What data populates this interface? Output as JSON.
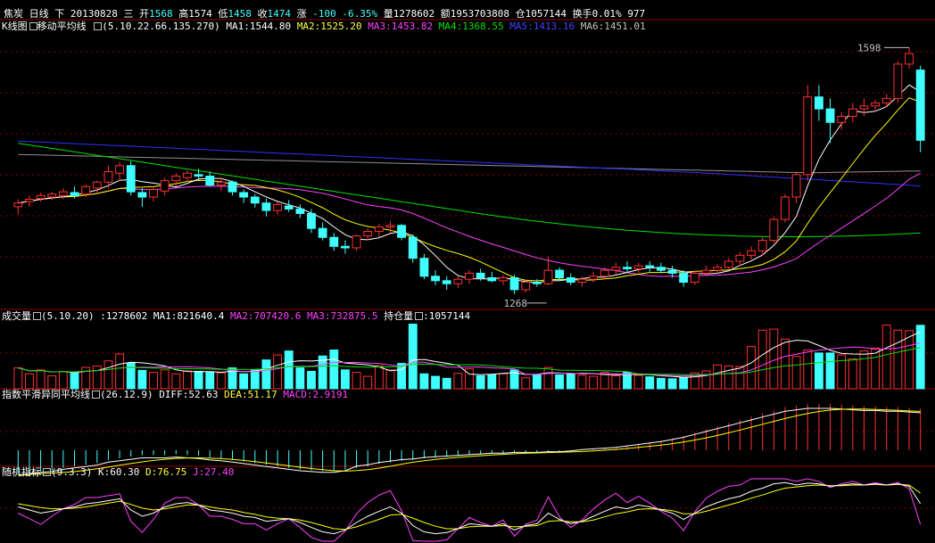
{
  "header": {
    "name": "焦炭",
    "period": "日线",
    "direction": "下",
    "date": "20130828",
    "weekday": "三",
    "open_label": "开",
    "open": "1568",
    "high_label": "高",
    "high": "1574",
    "low_label": "低",
    "low": "1458",
    "close_label": "收",
    "close": "1474",
    "change_label": "涨",
    "change": "-100",
    "change_pct": "-6.35%",
    "volume_label": "量",
    "volume": "1278602",
    "amount_label": "额",
    "amount": "1953703808",
    "oi_label": "仓",
    "oi": "1057144",
    "turnover_label": "换手",
    "turnover": "0.01%",
    "extra": "977"
  },
  "kline_panel": {
    "title": "K线图",
    "indicator": "移动平均线",
    "params": "(5.10.22.66.135.270)",
    "ma1": "MA1:1544.80",
    "ma2": "MA2:1525.20",
    "ma3": "MA3:1453.82",
    "ma4": "MA4:1368.55",
    "ma5": "MA5:1413.16",
    "ma6": "MA6:1451.01",
    "high_mark": "1598",
    "low_mark": "1268"
  },
  "volume_panel": {
    "title": "成交量",
    "params": "(5.10.20)",
    "vol": ":1278602",
    "ma1": "MA1:821640.4",
    "ma2": "MA2:707420.6",
    "ma3": "MA3:732875.5",
    "oi_label": "持仓量",
    "oi": ":1057144"
  },
  "macd_panel": {
    "title": "指数平滑异同平均线",
    "params": "(26.12.9)",
    "diff": "DIFF:52.63",
    "dea": "DEA:51.17",
    "macd": "MACD:2.9191"
  },
  "kdj_panel": {
    "title": "随机指标",
    "params": "(9.3.3)",
    "k": "K:60.30",
    "d": "D:76.75",
    "j": "J:27.40"
  },
  "colors": {
    "up": "#ff3030",
    "down": "#40ffff",
    "ma1": "#ffffff",
    "ma2": "#ffff00",
    "ma3": "#ff40ff",
    "ma4": "#00e000",
    "ma5": "#3030ff",
    "ma6": "#909090",
    "grid": "#8b0000"
  },
  "chart_data": {
    "type": "candlestick",
    "price_range": [
      1250,
      1620
    ],
    "candles": [
      [
        1385,
        1395,
        1375,
        1390
      ],
      [
        1392,
        1400,
        1385,
        1395
      ],
      [
        1396,
        1404,
        1392,
        1400
      ],
      [
        1398,
        1405,
        1394,
        1402
      ],
      [
        1400,
        1410,
        1395,
        1405
      ],
      [
        1404,
        1412,
        1396,
        1400
      ],
      [
        1402,
        1415,
        1398,
        1412
      ],
      [
        1410,
        1420,
        1404,
        1418
      ],
      [
        1418,
        1440,
        1410,
        1432
      ],
      [
        1430,
        1445,
        1420,
        1440
      ],
      [
        1440,
        1446,
        1400,
        1405
      ],
      [
        1404,
        1410,
        1385,
        1398
      ],
      [
        1398,
        1412,
        1392,
        1408
      ],
      [
        1406,
        1424,
        1400,
        1420
      ],
      [
        1420,
        1430,
        1412,
        1426
      ],
      [
        1424,
        1434,
        1418,
        1430
      ],
      [
        1428,
        1436,
        1420,
        1426
      ],
      [
        1426,
        1432,
        1412,
        1414
      ],
      [
        1414,
        1424,
        1406,
        1418
      ],
      [
        1418,
        1420,
        1400,
        1405
      ],
      [
        1404,
        1408,
        1390,
        1398
      ],
      [
        1398,
        1402,
        1384,
        1390
      ],
      [
        1390,
        1396,
        1372,
        1380
      ],
      [
        1380,
        1392,
        1374,
        1388
      ],
      [
        1386,
        1394,
        1378,
        1382
      ],
      [
        1382,
        1388,
        1370,
        1376
      ],
      [
        1376,
        1382,
        1350,
        1356
      ],
      [
        1356,
        1364,
        1340,
        1344
      ],
      [
        1344,
        1350,
        1326,
        1332
      ],
      [
        1332,
        1340,
        1322,
        1330
      ],
      [
        1330,
        1348,
        1326,
        1346
      ],
      [
        1346,
        1356,
        1340,
        1352
      ],
      [
        1352,
        1362,
        1344,
        1358
      ],
      [
        1358,
        1366,
        1350,
        1360
      ],
      [
        1360,
        1362,
        1340,
        1344
      ],
      [
        1344,
        1348,
        1310,
        1316
      ],
      [
        1316,
        1322,
        1288,
        1292
      ],
      [
        1292,
        1300,
        1280,
        1286
      ],
      [
        1286,
        1292,
        1274,
        1282
      ],
      [
        1282,
        1292,
        1276,
        1288
      ],
      [
        1288,
        1300,
        1282,
        1296
      ],
      [
        1296,
        1302,
        1286,
        1290
      ],
      [
        1290,
        1298,
        1284,
        1286
      ],
      [
        1286,
        1294,
        1280,
        1290
      ],
      [
        1290,
        1294,
        1268,
        1274
      ],
      [
        1274,
        1286,
        1270,
        1284
      ],
      [
        1284,
        1288,
        1278,
        1282
      ],
      [
        1282,
        1318,
        1280,
        1300
      ],
      [
        1300,
        1304,
        1286,
        1290
      ],
      [
        1290,
        1296,
        1280,
        1284
      ],
      [
        1284,
        1292,
        1278,
        1288
      ],
      [
        1288,
        1298,
        1284,
        1292
      ],
      [
        1292,
        1304,
        1288,
        1300
      ],
      [
        1300,
        1310,
        1294,
        1304
      ],
      [
        1304,
        1312,
        1296,
        1302
      ],
      [
        1302,
        1310,
        1296,
        1306
      ],
      [
        1306,
        1312,
        1298,
        1304
      ],
      [
        1304,
        1310,
        1296,
        1300
      ],
      [
        1300,
        1306,
        1290,
        1296
      ],
      [
        1296,
        1300,
        1278,
        1284
      ],
      [
        1284,
        1300,
        1280,
        1296
      ],
      [
        1296,
        1306,
        1292,
        1300
      ],
      [
        1300,
        1308,
        1296,
        1304
      ],
      [
        1304,
        1316,
        1300,
        1312
      ],
      [
        1312,
        1324,
        1306,
        1320
      ],
      [
        1320,
        1332,
        1314,
        1326
      ],
      [
        1326,
        1344,
        1320,
        1340
      ],
      [
        1340,
        1372,
        1336,
        1368
      ],
      [
        1368,
        1402,
        1364,
        1398
      ],
      [
        1398,
        1432,
        1390,
        1428
      ],
      [
        1428,
        1548,
        1420,
        1532
      ],
      [
        1532,
        1548,
        1500,
        1516
      ],
      [
        1516,
        1530,
        1470,
        1498
      ],
      [
        1498,
        1512,
        1488,
        1506
      ],
      [
        1506,
        1524,
        1498,
        1516
      ],
      [
        1516,
        1530,
        1506,
        1520
      ],
      [
        1520,
        1528,
        1512,
        1524
      ],
      [
        1524,
        1536,
        1518,
        1530
      ],
      [
        1530,
        1580,
        1524,
        1576
      ],
      [
        1576,
        1598,
        1570,
        1590
      ],
      [
        1568,
        1574,
        1458,
        1474
      ]
    ],
    "volume": [
      420,
      300,
      380,
      260,
      350,
      330,
      430,
      460,
      560,
      700,
      520,
      370,
      330,
      380,
      300,
      360,
      350,
      330,
      320,
      420,
      300,
      380,
      580,
      680,
      760,
      420,
      350,
      660,
      780,
      380,
      330,
      250,
      460,
      380,
      510,
      1300,
      300,
      250,
      210,
      310,
      400,
      260,
      280,
      300,
      380,
      220,
      280,
      430,
      280,
      300,
      270,
      250,
      330,
      260,
      330,
      270,
      240,
      210,
      200,
      230,
      320,
      360,
      480,
      460,
      450,
      850,
      1180,
      1200,
      1000,
      650,
      780,
      720,
      720,
      680,
      600,
      760,
      820,
      1280,
      1180,
      1170,
      1278
    ],
    "macd_hist": [
      -30,
      -28,
      -26,
      -25,
      -22,
      -20,
      -18,
      -16,
      -12,
      -10,
      -8,
      -6,
      -6,
      -6,
      -5,
      -6,
      -7,
      -9,
      -10,
      -12,
      -14,
      -16,
      -18,
      -20,
      -22,
      -24,
      -25,
      -26,
      -26,
      -24,
      -22,
      -20,
      -17,
      -15,
      -13,
      -12,
      -10,
      -9,
      -8,
      -7,
      -6,
      -5,
      -4,
      -4,
      -3,
      -3,
      -3,
      -2,
      -2,
      -1,
      1,
      2,
      3,
      4,
      6,
      8,
      10,
      12,
      15,
      18,
      22,
      26,
      30,
      34,
      38,
      42,
      46,
      50,
      54,
      56,
      58,
      58,
      58,
      57,
      56,
      55,
      55,
      54,
      54,
      53,
      52
    ],
    "kd_k": [
      55,
      50,
      45,
      48,
      52,
      55,
      60,
      62,
      65,
      68,
      50,
      40,
      45,
      55,
      60,
      62,
      58,
      50,
      48,
      45,
      40,
      38,
      32,
      34,
      36,
      30,
      22,
      15,
      12,
      18,
      30,
      40,
      48,
      55,
      45,
      25,
      15,
      12,
      14,
      20,
      28,
      26,
      24,
      28,
      18,
      25,
      28,
      45,
      35,
      28,
      32,
      40,
      48,
      55,
      52,
      58,
      55,
      50,
      45,
      35,
      45,
      55,
      62,
      68,
      72,
      80,
      85,
      92,
      94,
      90,
      93,
      92,
      88,
      90,
      92,
      90,
      92,
      90,
      92,
      88,
      60
    ],
    "kd_d": [
      60,
      57,
      54,
      52,
      52,
      53,
      55,
      58,
      61,
      64,
      59,
      53,
      50,
      52,
      55,
      58,
      58,
      55,
      52,
      50,
      46,
      43,
      39,
      37,
      36,
      34,
      30,
      25,
      20,
      19,
      23,
      29,
      35,
      42,
      43,
      37,
      30,
      24,
      20,
      20,
      23,
      24,
      24,
      25,
      23,
      24,
      25,
      32,
      33,
      31,
      31,
      34,
      39,
      44,
      47,
      51,
      52,
      51,
      49,
      44,
      44,
      48,
      53,
      58,
      63,
      69,
      74,
      80,
      85,
      87,
      89,
      90,
      89,
      89,
      90,
      90,
      91,
      90,
      91,
      90,
      77
    ],
    "kd_j": [
      45,
      36,
      27,
      40,
      52,
      59,
      70,
      70,
      73,
      76,
      32,
      14,
      35,
      61,
      70,
      70,
      58,
      40,
      40,
      35,
      28,
      28,
      18,
      28,
      36,
      22,
      6,
      0,
      0,
      16,
      44,
      62,
      74,
      81,
      49,
      1,
      0,
      0,
      2,
      20,
      38,
      30,
      24,
      34,
      8,
      27,
      34,
      71,
      39,
      22,
      34,
      52,
      66,
      77,
      62,
      72,
      61,
      48,
      37,
      17,
      47,
      69,
      80,
      88,
      90,
      100,
      100,
      100,
      100,
      96,
      100,
      96,
      86,
      92,
      96,
      90,
      94,
      90,
      94,
      84,
      27
    ]
  }
}
